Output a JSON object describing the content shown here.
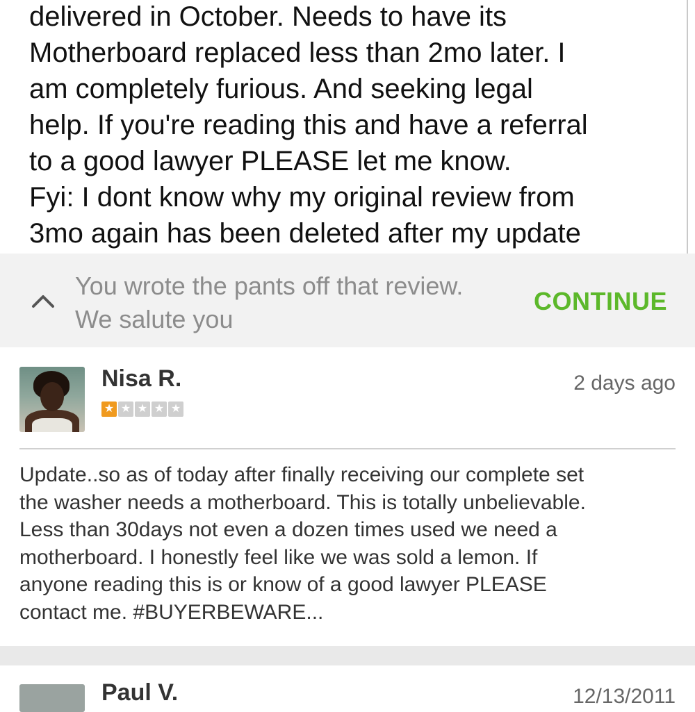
{
  "top_review": {
    "lines": [
      "delivered in October.  Needs to have its",
      "Motherboard replaced less than 2mo later. I",
      "am completely furious.  And seeking legal",
      "help. If you're reading this and have a referral",
      "to a good lawyer PLEASE let me know.",
      "Fyi: I dont know why my original review from",
      "3mo again has been deleted after my update"
    ]
  },
  "prompt": {
    "lines": [
      "You wrote the pants off that review.",
      "We salute you"
    ],
    "continue_label": "CONTINUE",
    "accent_color": "#5cb82a"
  },
  "review": {
    "reviewer_name": "Nisa R.",
    "rating": 1,
    "rating_max": 5,
    "date": "2 days ago",
    "body_lines": [
      "Update..so as of today after finally receiving our complete set",
      "the washer needs a motherboard. This is totally unbelievable.",
      "Less than 30days not even a dozen times used we need a",
      "motherboard.  I honestly feel like we was sold a lemon. If",
      "anyone reading this is or know of a good lawyer PLEASE",
      "contact me. #BUYERBEWARE..."
    ],
    "star_filled_color": "#f09a1f"
  },
  "next_review": {
    "reviewer_name": "Paul V.",
    "date": "12/13/2011"
  }
}
